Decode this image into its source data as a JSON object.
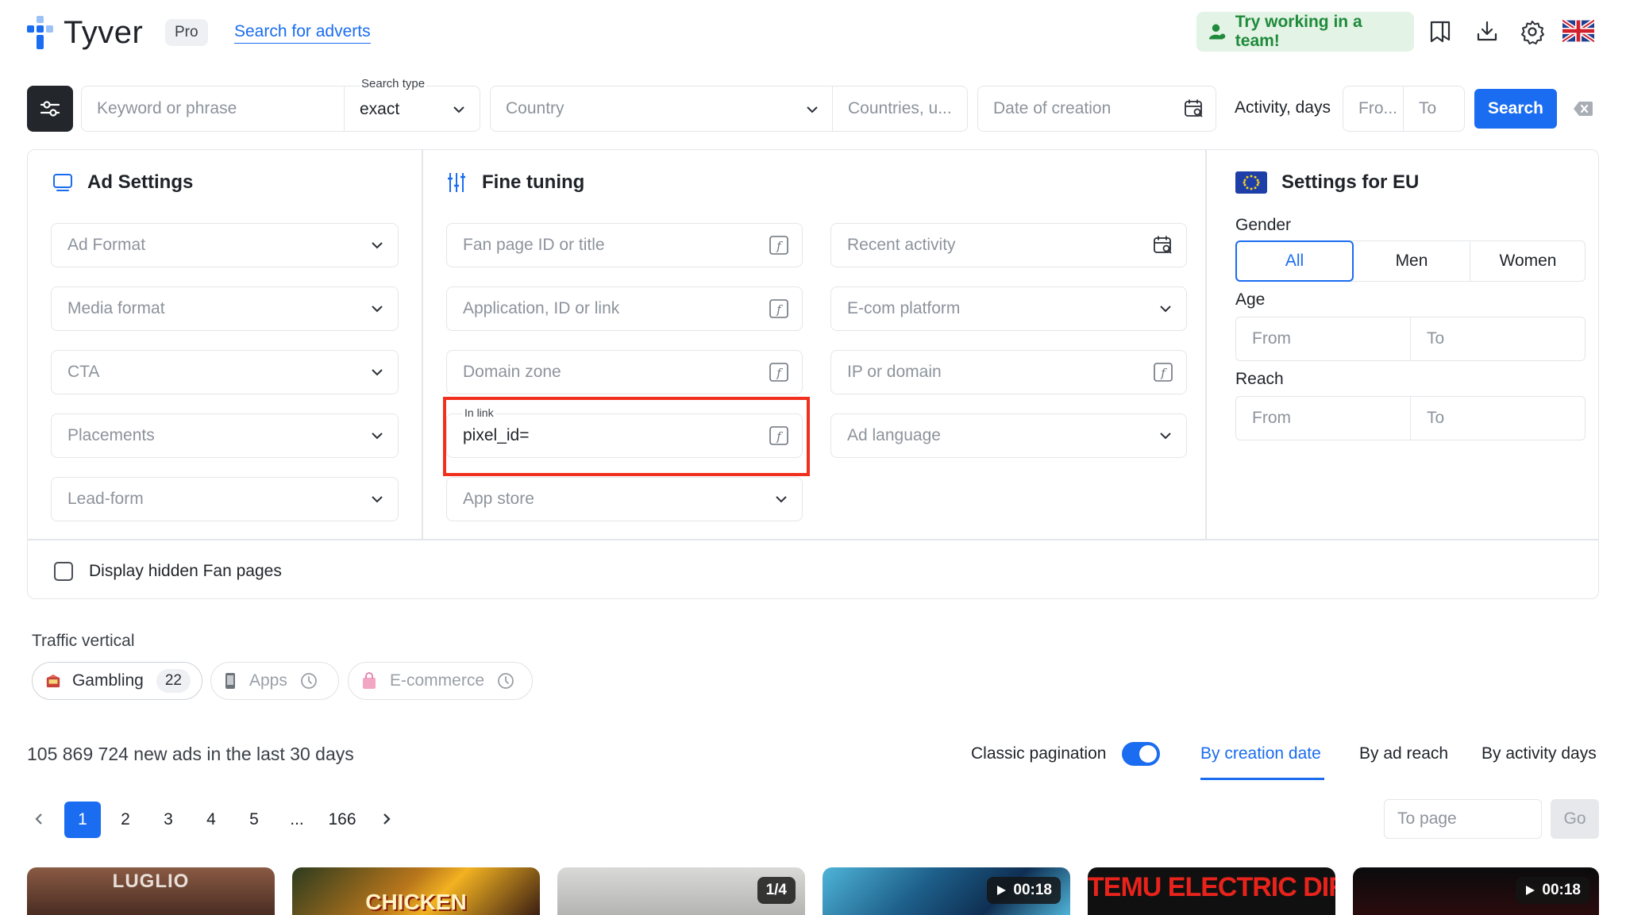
{
  "header": {
    "brand": "Tyver",
    "plan_badge": "Pro",
    "nav_link": "Search for adverts",
    "team_button": "Try working in a team!"
  },
  "search_bar": {
    "keyword_placeholder": "Keyword or phrase",
    "search_type_label": "Search type",
    "search_type_value": "exact",
    "country_placeholder": "Country",
    "countries_placeholder": "Countries, u...",
    "date_placeholder": "Date of creation",
    "activity_label": "Activity, days",
    "activity_from_placeholder": "Fro...",
    "activity_to_placeholder": "To",
    "search_button": "Search"
  },
  "ad_settings": {
    "title": "Ad Settings",
    "fields": [
      "Ad Format",
      "Media format",
      "CTA",
      "Placements",
      "Lead-form"
    ]
  },
  "fine_tuning": {
    "title": "Fine tuning",
    "col1": {
      "fan_page": "Fan page ID or title",
      "application": "Application, ID or link",
      "domain_zone": "Domain zone",
      "in_link_label": "In link",
      "in_link_value": "pixel_id=",
      "app_store": "App store"
    },
    "col2": {
      "recent_activity": "Recent activity",
      "ecom_platform": "E-com platform",
      "ip_domain": "IP or domain",
      "ad_language": "Ad language"
    }
  },
  "eu_settings": {
    "title": "Settings for EU",
    "gender_label": "Gender",
    "gender_options": [
      "All",
      "Men",
      "Women"
    ],
    "age_label": "Age",
    "age_from": "From",
    "age_to": "To",
    "reach_label": "Reach",
    "reach_from": "From",
    "reach_to": "To"
  },
  "hidden_pages_label": "Display hidden Fan pages",
  "traffic": {
    "label": "Traffic vertical",
    "chips": [
      {
        "label": "Gambling",
        "count": "22"
      },
      {
        "label": "Apps"
      },
      {
        "label": "E-commerce"
      }
    ]
  },
  "results": {
    "summary": "105 869 724 new ads in the last 30 days",
    "classic_pagination_label": "Classic pagination",
    "sort_options": [
      "By creation date",
      "By ad reach",
      "By activity days"
    ]
  },
  "pagination": {
    "pages": [
      "1",
      "2",
      "3",
      "4",
      "5",
      "...",
      "166"
    ],
    "to_page_placeholder": "To page",
    "go_button": "Go"
  },
  "thumbnails": [
    {
      "caption": "LUGLIO",
      "badge": ""
    },
    {
      "caption": "CHICKEN",
      "badge": ""
    },
    {
      "caption": "",
      "badge": "1/4"
    },
    {
      "caption": "",
      "badge": "00:18"
    },
    {
      "caption": "TEMU ELECTRIC DIRT BIKE",
      "badge": ""
    },
    {
      "caption": "",
      "badge": "00:18"
    }
  ],
  "colors": {
    "accent": "#1a6cf0",
    "highlight_box": "#f0301d",
    "team_bg": "#e3f3e5",
    "team_text": "#1e8a3a"
  }
}
